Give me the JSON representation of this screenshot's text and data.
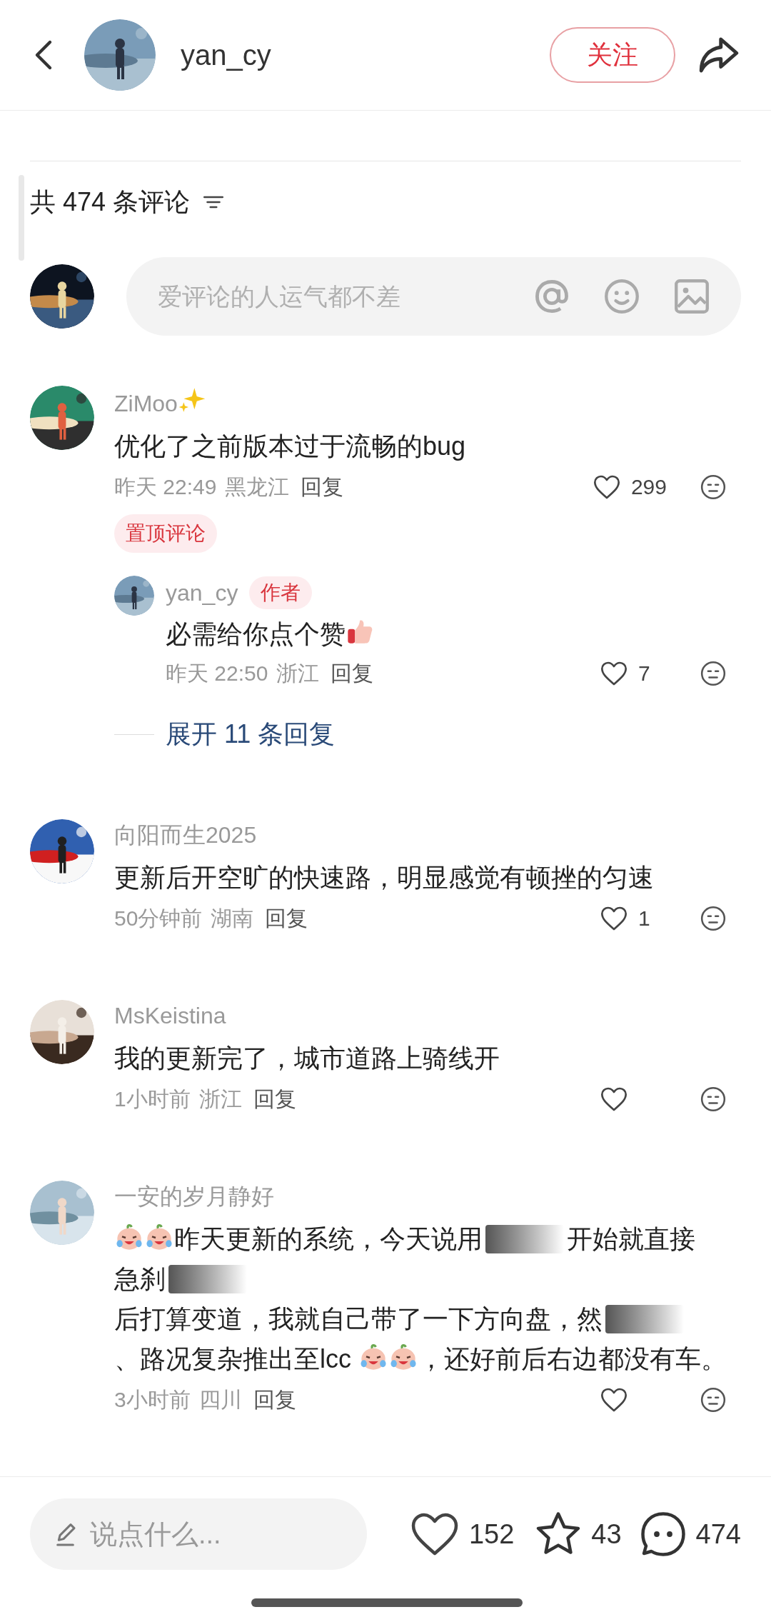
{
  "header": {
    "username": "yan_cy",
    "follow_button": "关注"
  },
  "comment_count": "共 474 条评论",
  "comment_input": {
    "placeholder": "爱评论的人运气都不差"
  },
  "comments": [
    {
      "user": [
        {
          "kind": "text",
          "text": "ZiMoo"
        },
        {
          "kind": "sparkle"
        }
      ],
      "content": [
        {
          "kind": "text",
          "text": "优化了之前版本过于流畅的bug"
        }
      ],
      "time": "昨天 22:49",
      "location": "黑龙江",
      "reply": "回复",
      "likes": "299",
      "pinned": "置顶评论",
      "replies": [
        {
          "user": "yan_cy",
          "tag": "作者",
          "content": [
            {
              "kind": "text",
              "text": "必需给你点个赞"
            },
            {
              "kind": "thumbsup"
            }
          ],
          "time": "昨天 22:50",
          "location": "浙江",
          "reply": "回复",
          "likes": "7"
        }
      ],
      "expand": "展开 11 条回复"
    },
    {
      "user": [
        {
          "kind": "text",
          "text": "向阳而生2025"
        }
      ],
      "content": [
        {
          "kind": "text",
          "text": "更新后开空旷的快速路，明显感觉有顿挫的匀速"
        }
      ],
      "time": "50分钟前",
      "location": "湖南",
      "reply": "回复",
      "likes": "1"
    },
    {
      "user": [
        {
          "kind": "text",
          "text": "MsKeistina"
        }
      ],
      "content": [
        {
          "kind": "text",
          "text": "我的更新完了，城市道路上骑线开"
        }
      ],
      "time": "1小时前",
      "location": "浙江",
      "reply": "回复"
    },
    {
      "user": [
        {
          "kind": "text",
          "text": "一安的岁月静好"
        }
      ],
      "content": [
        {
          "kind": "laughcry"
        },
        {
          "kind": "laughcry"
        },
        {
          "kind": "text",
          "text": "昨天更新的系统，今天说用"
        },
        {
          "kind": "redaction"
        },
        {
          "kind": "text",
          "text": "开始就直接"
        },
        {
          "kind": "text",
          "text": "急刹"
        },
        {
          "kind": "redaction"
        },
        {
          "kind": "text",
          "text": "后打算变道，我就自己带了一下方向盘，然"
        },
        {
          "kind": "redaction"
        },
        {
          "kind": "text",
          "text": "、路况复杂推出至lcc "
        },
        {
          "kind": "laughcry"
        },
        {
          "kind": "laughcry"
        },
        {
          "kind": "text",
          "text": "，还好前后右边"
        },
        {
          "kind": "text",
          "text": "都没有车。"
        }
      ],
      "time": "3小时前",
      "location": "四川",
      "reply": "回复"
    }
  ],
  "bottom_bar": {
    "placeholder": "说点什么...",
    "likes": "152",
    "favorites": "43",
    "comments": "474"
  }
}
